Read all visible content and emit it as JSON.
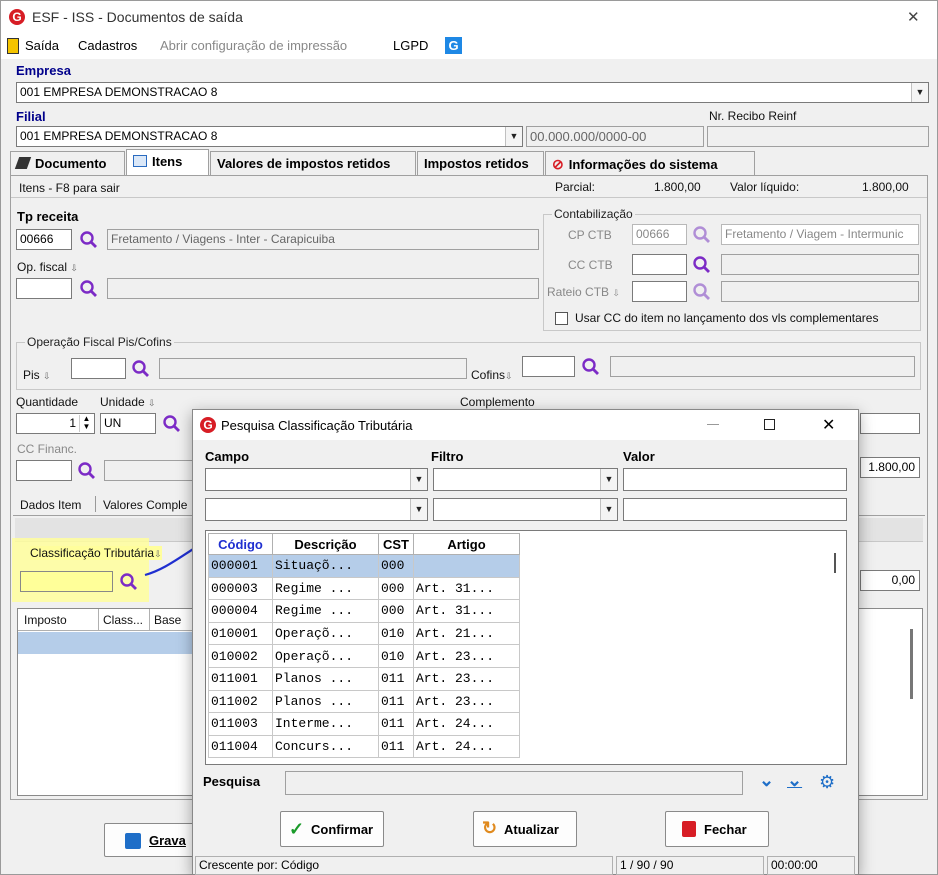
{
  "window": {
    "title": "ESF - ISS - Documentos de saída",
    "close_glyph": "✕"
  },
  "menu": {
    "items": [
      "Saída",
      "Cadastros",
      "Abrir configuração de impressão",
      "LGPD"
    ]
  },
  "empresa": {
    "label": "Empresa",
    "value": "001 EMPRESA DEMONSTRACAO 8"
  },
  "filial": {
    "label": "Filial",
    "value": "001 EMPRESA DEMONSTRACAO 8",
    "cnpj": "00.000.000/0000-00"
  },
  "recibo": {
    "label": "Nr. Recibo Reinf",
    "value": ""
  },
  "tabs": [
    "Documento",
    "Itens",
    "Valores de impostos retidos",
    "Impostos retidos",
    "Informações do sistema"
  ],
  "itens_header": {
    "title": "Itens - F8 para sair",
    "parcial_label": "Parcial:",
    "parcial_value": "1.800,00",
    "liquido_label": "Valor líquido:",
    "liquido_value": "1.800,00"
  },
  "tp_receita": {
    "label": "Tp receita",
    "code": "00666",
    "desc": "Fretamento / Viagens - Inter - Carapicuiba"
  },
  "op_fiscal": {
    "label": "Op. fiscal"
  },
  "contabilizacao": {
    "title": "Contabilização",
    "cp_ctb_label": "CP CTB",
    "cp_ctb_code": "00666",
    "cp_ctb_desc": "Fretamento / Viagem - Intermunic",
    "cc_ctb_label": "CC CTB",
    "rateio_label": "Rateio CTB",
    "usar_cc_label": "Usar CC do item no lançamento dos vls complementares"
  },
  "pis_cofins": {
    "title": "Operação Fiscal Pis/Cofins",
    "pis_label": "Pis",
    "cofins_label": "Cofins"
  },
  "quantidade": {
    "label": "Quantidade",
    "value": "1"
  },
  "unidade": {
    "label": "Unidade",
    "value": "UN"
  },
  "complemento": {
    "label": "Complemento"
  },
  "cc_financ": {
    "label": "CC Financ."
  },
  "total_right": "1.800,00",
  "subtabs": [
    "Dados Item",
    "Valores Comple"
  ],
  "class_trib": {
    "label": "Classificação Tributária",
    "value": ""
  },
  "imposto_grid": {
    "headers": [
      "Imposto",
      "Class...",
      "Base"
    ],
    "right_value": "0,00"
  },
  "save_button": "Grava",
  "dialog": {
    "title": "Pesquisa Classificação Tributária",
    "campo_label": "Campo",
    "filtro_label": "Filtro",
    "valor_label": "Valor",
    "columns": [
      "Código",
      "Descrição",
      "CST",
      "Artigo"
    ],
    "rows": [
      {
        "codigo": "000001",
        "descricao": "Situaçõ...",
        "cst": "000",
        "artigo": ""
      },
      {
        "codigo": "000003",
        "descricao": "Regime ...",
        "cst": "000",
        "artigo": "Art. 31..."
      },
      {
        "codigo": "000004",
        "descricao": "Regime ...",
        "cst": "000",
        "artigo": "Art. 31..."
      },
      {
        "codigo": "010001",
        "descricao": "Operaçõ...",
        "cst": "010",
        "artigo": "Art. 21..."
      },
      {
        "codigo": "010002",
        "descricao": "Operaçõ...",
        "cst": "010",
        "artigo": "Art. 23..."
      },
      {
        "codigo": "011001",
        "descricao": "Planos ...",
        "cst": "011",
        "artigo": "Art. 23..."
      },
      {
        "codigo": "011002",
        "descricao": "Planos ...",
        "cst": "011",
        "artigo": "Art. 23..."
      },
      {
        "codigo": "011003",
        "descricao": "Interme...",
        "cst": "011",
        "artigo": "Art. 24..."
      },
      {
        "codigo": "011004",
        "descricao": "Concurs...",
        "cst": "011",
        "artigo": "Art. 24..."
      }
    ],
    "pesquisa_label": "Pesquisa",
    "confirmar": "Confirmar",
    "atualizar": "Atualizar",
    "fechar": "Fechar",
    "status_order": "Crescente por: Código",
    "status_count": "1 / 90 / 90",
    "status_time": "00:00:00"
  }
}
